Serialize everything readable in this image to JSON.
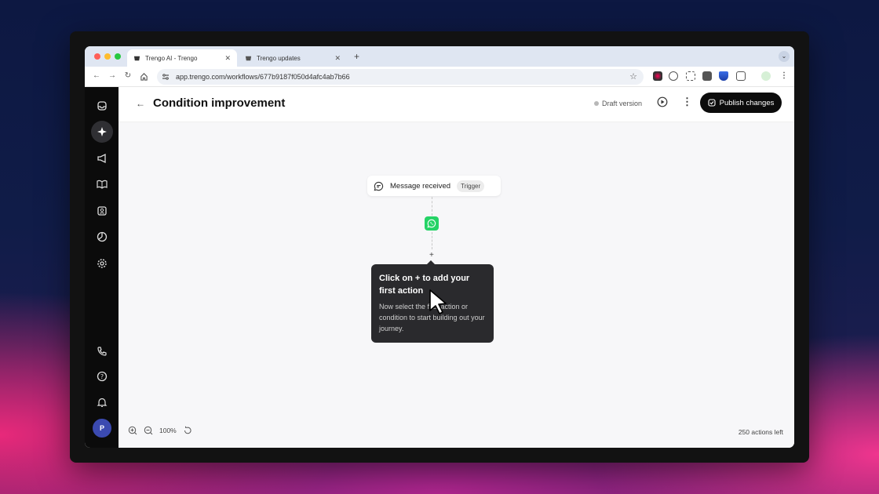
{
  "browser": {
    "tabs": [
      {
        "label": "Trengo AI - Trengo",
        "active": true
      },
      {
        "label": "Trengo updates",
        "active": false
      }
    ],
    "url": "app.trengo.com/workflows/677b9187f050d4afc4ab7b66"
  },
  "header": {
    "title": "Condition improvement",
    "draft_label": "Draft version",
    "publish_label": "Publish changes"
  },
  "sidebar": {
    "items": [
      "inbox-icon",
      "ai-sparkle-icon",
      "megaphone-icon",
      "book-icon",
      "contacts-icon",
      "reports-icon",
      "settings-icon"
    ],
    "bottom_items": [
      "phone-icon",
      "help-icon",
      "bell-icon"
    ],
    "avatar_initial": "P"
  },
  "canvas": {
    "trigger_label": "Message received",
    "trigger_badge": "Trigger",
    "add_symbol": "+",
    "tooltip_title": "Click on + to add your first action",
    "tooltip_body": "Now select the first action or condition to start building out your journey."
  },
  "footer": {
    "zoom_level": "100%",
    "actions_left": "250 actions left"
  },
  "colors": {
    "accent": "#0c0c0c",
    "whatsapp": "#25d366",
    "sidebar_bg": "#0b0b0b",
    "avatar": "#3b4ab0"
  }
}
